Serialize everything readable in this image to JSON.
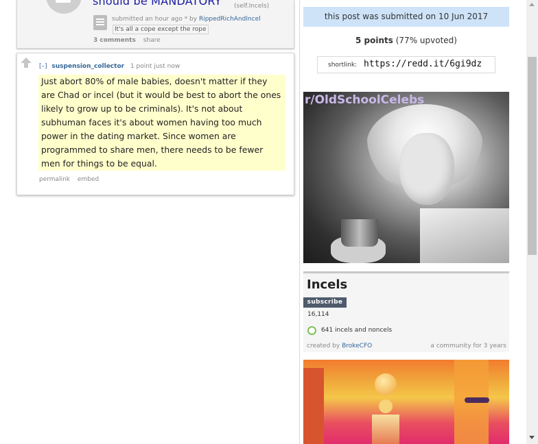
{
  "post": {
    "title": "should be MANDATORY",
    "domain": "(self.Incels)",
    "submitted": "submitted an hour ago * by",
    "author": "RippedRichAndIncel",
    "flair": "It's all a cope except the rope",
    "comments": "3 comments",
    "share": "share"
  },
  "comment": {
    "collapse": "[–]",
    "author": "suspension_collector",
    "meta": "1 point just now",
    "body": "Just abort 80% of male babies, doesn't matter if they are Chad or incel (but it would be best to abort the ones likely to grow up to be criminals). It's not about subhuman faces it's about women having too much power in the dating market. Since women are programmed to share men, there needs to be fewer men for things to be equal.",
    "permalink": "permalink",
    "embed": "embed"
  },
  "sidebar": {
    "date_notice": "this post was submitted on 10 Jun 2017",
    "points_bold": "5 points",
    "points_rest": " (77% upvoted)",
    "shortlink_label": "shortlink:",
    "shortlink_value": "https://redd.it/6gi9dz",
    "ad_label": "r/OldSchoolCelebs",
    "subreddit": {
      "name": "Incels",
      "subscribe_label": "subscribe",
      "subscribers": "16,114",
      "online": "641 incels and noncels",
      "created_prefix": "created by",
      "creator": "BrokeCFO",
      "age": "a community for 3 years"
    }
  },
  "colors": {
    "link": "#336699",
    "title": "#1a1aa6",
    "highlight": "#ffffcc",
    "notice_bg": "#cee3f8",
    "online_ring": "#7fc15c"
  }
}
